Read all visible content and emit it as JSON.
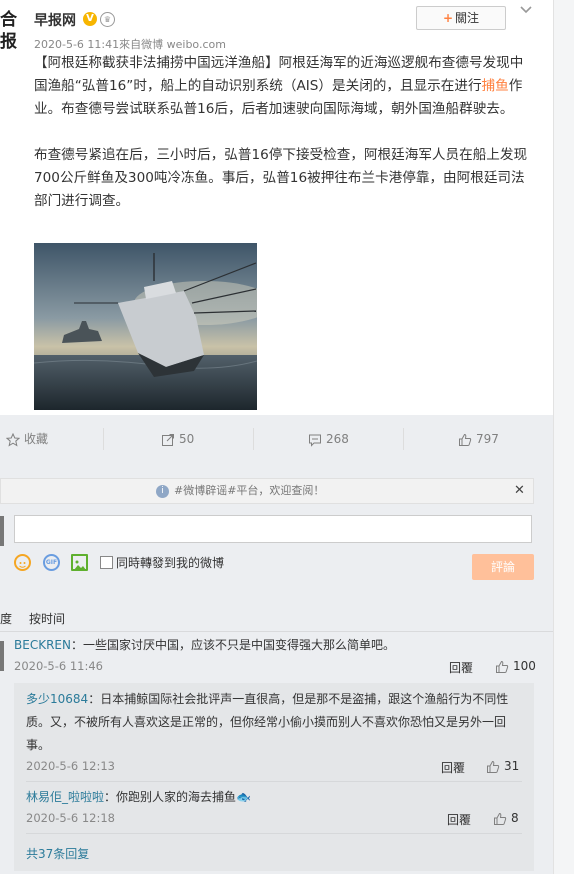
{
  "post": {
    "avatar_text": "合报",
    "author": "早报网",
    "meta": "2020-5-6 11:41來自微博 weibo.com",
    "follow_label": "關注",
    "text_p1": "【阿根廷称截获非法捕捞中国远洋渔船】阿根廷海军的近海巡逻舰布查德号发现中国渔船“弘普16”时，船上的自动识别系统（AIS）是关闭的，且显示在进行",
    "text_p1_hl": "捕鱼",
    "text_p1_end": "作业。布查德号尝试联系弘普16后，后者加速驶向国际海域，朝外国渔船群驶去。",
    "text_p2": "布查德号紧追在后，三小时后，弘普16停下接受检查，阿根廷海军人员在船上发现700公斤鲜鱼及300吨冷冻鱼。事后，弘普16被押往布兰卡港停靠，由阿根廷司法部门进行调查。"
  },
  "actions": {
    "favorite": "收藏",
    "repost": "50",
    "comment": "268",
    "like": "797"
  },
  "notice": {
    "text": "#微博辟谣#平台，欢迎查阅！"
  },
  "composer": {
    "checkbox_label": "同時轉發到我的微博",
    "post_button": "評論"
  },
  "sort": {
    "left": "度",
    "by_time": "按时间"
  },
  "comments": [
    {
      "user": "BECKREN",
      "text": "：一些国家讨厌中国，应该不只是中国变得强大那么简单吧。",
      "time": "2020-5-6 11:46",
      "reply": "回覆",
      "likes": "100"
    }
  ],
  "replies": [
    {
      "user": "多少10684",
      "text": "：日本捕鲸国际社会批评声一直很高，但是那不是盗捕，跟这个渔船行为不同性质。又，不被所有人喜欢这是正常的，但你经常小偷小摸而别人不喜欢你恐怕又是另外一回事。",
      "time": "2020-5-6 12:13",
      "reply": "回覆",
      "likes": "31"
    },
    {
      "user": "林易佢_啦啦啦",
      "text": "：你跑别人家的海去捕鱼🐟",
      "time": "2020-5-6 12:18",
      "reply": "回覆",
      "likes": "8"
    }
  ],
  "more_replies": "共37条回复"
}
